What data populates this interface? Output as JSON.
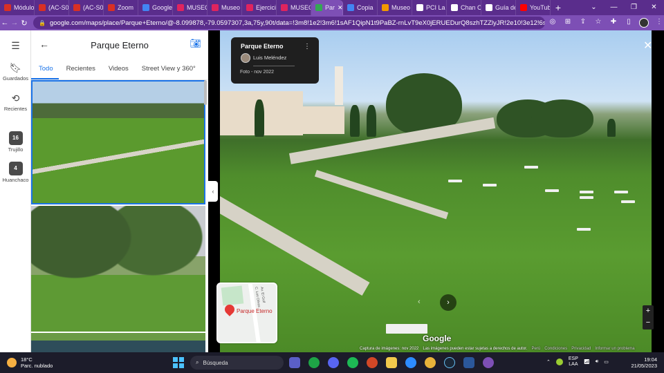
{
  "browser": {
    "tabs": [
      {
        "title": "Módulo",
        "color": "#d93025",
        "active": false
      },
      {
        "title": "(AC-S0",
        "color": "#d93025",
        "active": false
      },
      {
        "title": "(AC-S0",
        "color": "#d93025",
        "active": false
      },
      {
        "title": "Zoom",
        "color": "#d93025",
        "active": false
      },
      {
        "title": "Google",
        "color": "#4285f4",
        "active": false
      },
      {
        "title": "MUSEO",
        "color": "#e0245e",
        "active": false
      },
      {
        "title": "Museo",
        "color": "#e0245e",
        "active": false
      },
      {
        "title": "Ejercicio",
        "color": "#e0245e",
        "active": false
      },
      {
        "title": "MUSEO",
        "color": "#e0245e",
        "active": false
      },
      {
        "title": "Par",
        "color": "#34a853",
        "active": true
      },
      {
        "title": "Copia",
        "color": "#4285f4",
        "active": false
      },
      {
        "title": "Museo",
        "color": "#f29900",
        "active": false
      },
      {
        "title": "PCI La",
        "color": "#ffffff",
        "active": false
      },
      {
        "title": "Chan C",
        "color": "#ffffff",
        "active": false
      },
      {
        "title": "Guía de",
        "color": "#ffffff",
        "active": false
      },
      {
        "title": "YouTube",
        "color": "#ff0000",
        "active": false
      }
    ],
    "url": "google.com/maps/place/Parque+Eterno/@-8.099878,-79.0597307,3a,75y,90t/data=!3m8!1e2!3m6!1sAF1QipN1t9PaBZ-rnLvT9eX0jERUEDurQ8szhTZZlyJR!2e10!3e12!6shttps:%2F%2..."
  },
  "rail": {
    "saved_label": "Guardados",
    "recent_label": "Recientes",
    "place1_label": "Trujillo",
    "place1_badge": "16",
    "place2_label": "Huanchaco",
    "place2_badge": "4"
  },
  "panel": {
    "title": "Parque Eterno",
    "tabs": [
      "Todo",
      "Recientes",
      "Videos",
      "Street View y 360°"
    ],
    "active_tab": "Todo"
  },
  "photo_card": {
    "title": "Parque Eterno",
    "author": "Luis Meléndez",
    "date": "Foto - nov 2022"
  },
  "minimap": {
    "place_label": "Parque Eterno",
    "street1": "C. Los Olivos",
    "street2": "Av. El Golf"
  },
  "viewer": {
    "brand": "Google",
    "attribution": "Captura de imágenes: nov 2022",
    "copyright_note": "Las imágenes pueden estar sujetas a derechos de autor.",
    "links": [
      "Perú",
      "Condiciones",
      "Privacidad",
      "Informar un problema"
    ]
  },
  "taskbar": {
    "temperature": "18°C",
    "weather_text": "Parc. nublado",
    "search_placeholder": "Búsqueda",
    "lang_line1": "ESP",
    "lang_line2": "LAA",
    "time": "19:04",
    "date": "21/05/2023"
  },
  "colors": {
    "browser_frame": "#5a2d8c",
    "browser_toolbar": "#7d4fb5",
    "maps_accent": "#1a73e8",
    "taskbar": "#1c1c2a"
  }
}
